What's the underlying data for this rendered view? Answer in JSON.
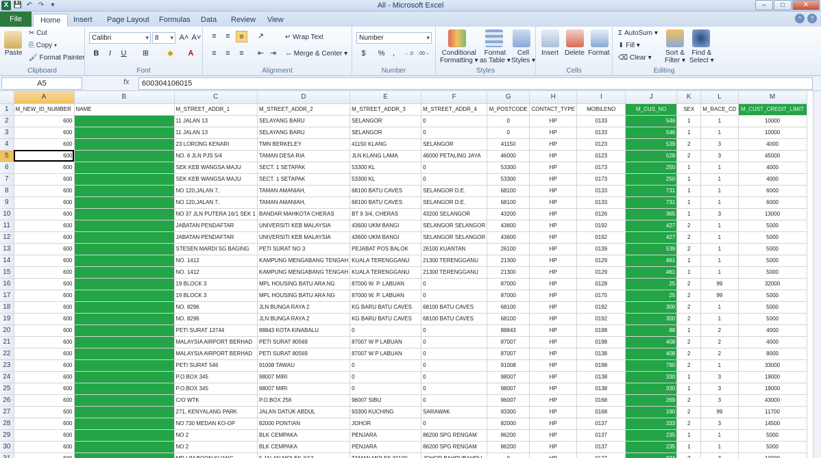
{
  "window": {
    "title": "All - Microsoft Excel",
    "min": "–",
    "max": "□",
    "close": "✕"
  },
  "quick_access": {
    "logo": "X",
    "save": "💾",
    "undo": "↶",
    "redo": "↷",
    "custom": "▾"
  },
  "tabs": [
    {
      "label": "File"
    },
    {
      "label": "Home"
    },
    {
      "label": "Insert"
    },
    {
      "label": "Page Layout"
    },
    {
      "label": "Formulas"
    },
    {
      "label": "Data"
    },
    {
      "label": "Review"
    },
    {
      "label": "View"
    }
  ],
  "ribbon": {
    "clipboard": {
      "paste": "Paste",
      "cut": "Cut",
      "copy": "Copy ▾",
      "format_painter": "Format Painter",
      "label": "Clipboard"
    },
    "font": {
      "name": "Calibri",
      "size": "8",
      "bold": "B",
      "italic": "I",
      "underline": "U",
      "grow": "A˄",
      "shrink": "A˅",
      "label": "Font"
    },
    "alignment": {
      "wrap": "Wrap Text",
      "merge": "Merge & Center",
      "label": "Alignment"
    },
    "number": {
      "format": "Number",
      "currency": "$",
      "percent": "%",
      "comma": ",",
      "inc": "←.0",
      "dec": ".00→",
      "label": "Number"
    },
    "styles": {
      "conditional": "Conditional",
      "conditional2": "Formatting ▾",
      "format_table": "Format",
      "format_table2": "as Table ▾",
      "cell_styles": "Cell",
      "cell_styles2": "Styles ▾",
      "label": "Styles"
    },
    "cells": {
      "insert": "Insert",
      "delete": "Delete",
      "format": "Format",
      "label": "Cells"
    },
    "editing": {
      "autosum": "Σ AutoSum ▾",
      "fill": "Fill ▾",
      "clear": "Clear ▾",
      "sort": "Sort &",
      "sort2": "Filter ▾",
      "find": "Find &",
      "find2": "Select ▾",
      "label": "Editing"
    }
  },
  "formula_bar": {
    "name_box": "A5",
    "fx": "fx",
    "content": "600304106015"
  },
  "columns": [
    "A",
    "B",
    "C",
    "D",
    "E",
    "F",
    "G",
    "H",
    "I",
    "J",
    "K",
    "L",
    "M"
  ],
  "header_row": [
    "M_NEW_ID_NUMBER",
    "NAME",
    "M_STREET_ADDR_1",
    "M_STREET_ADDR_2",
    "M_STREET_ADDR_3",
    "M_STREET_ADDR_4",
    "M_POSTCODE",
    "CONTACT_TYPE",
    "MOBILENO",
    "M_CUS_NO",
    "SEX",
    "M_RACE_CD",
    "M_CUST_CREDIT_LIMIT"
  ],
  "rows": [
    [
      "600",
      "",
      "11 JALAN 13",
      "SELAYANG BARU",
      "SELANGOR",
      "0",
      "0",
      "HP",
      "0133",
      "546",
      "1",
      "1",
      "10000"
    ],
    [
      "600",
      "",
      "11 JALAN 13",
      "SELAYANG BARU",
      "SELANGOR",
      "0",
      "0",
      "HP",
      "0133",
      "546",
      "1",
      "1",
      "10000"
    ],
    [
      "600",
      "",
      "23 LORONG KENARI",
      "TMN BERKELEY",
      "41150 KLANG",
      "SELANGOR",
      "41150",
      "HP",
      "0123",
      "539",
      "2",
      "3",
      "4000"
    ],
    [
      "600",
      "",
      "NO. 6 JLN PJS 5/4",
      "TAMAN DESA RIA",
      "JLN KLANG LAMA",
      "46000 PETALING JAYA",
      "46000",
      "HP",
      "0123",
      "528",
      "2",
      "3",
      "45000"
    ],
    [
      "600",
      "",
      "SEK KEB WANGSA MAJU",
      "SECT. 1 SETAPAK",
      "53300 KL",
      "0",
      "53300",
      "HP",
      "0173",
      "250",
      "1",
      "1",
      "4000"
    ],
    [
      "600",
      "",
      "SEK KEB WANGSA MAJU",
      "SECT. 1 SETAPAK",
      "53300 KL",
      "0",
      "53300",
      "HP",
      "0173",
      "250",
      "1",
      "1",
      "4000"
    ],
    [
      "600",
      "",
      "NO 120,JALAN 7,",
      "TAMAN AMANIAH,",
      "68100 BATU CAVES",
      "SELANGOR D.E.",
      "68100",
      "HP",
      "0133",
      "731",
      "1",
      "1",
      "6000"
    ],
    [
      "600",
      "",
      "NO 120,JALAN 7,",
      "TAMAN AMANIAH,",
      "68100 BATU CAVES",
      "SELANGOR D.E.",
      "68100",
      "HP",
      "0133",
      "731",
      "1",
      "1",
      "6000"
    ],
    [
      "600",
      "",
      "NO 37 JLN PUTERA 16/1 SEK 1",
      "BANDAR MAHKOTA CHERAS",
      "BT 9 3/4, CHERAS",
      "43200 SELANGOR",
      "43200",
      "HP",
      "0126",
      "365",
      "1",
      "3",
      "13000"
    ],
    [
      "600",
      "",
      "JABATAN PENDAFTAR",
      "UNIVERSITI KEB MALAYSIA",
      "43600 UKM BANGI",
      "SELANGOR SELANGOR",
      "43600",
      "HP",
      "0192",
      "427",
      "2",
      "1",
      "5000"
    ],
    [
      "600",
      "",
      "JABATAN PENDAFTAR",
      "UNIVERSITI KEB MALAYSIA",
      "43600 UKM BANGI",
      "SELANGOR SELANGOR",
      "43600",
      "HP",
      "0192",
      "427",
      "2",
      "1",
      "5000"
    ],
    [
      "600",
      "",
      "STESEN MARDI SG BAGING",
      "PETI SURAT NO 3",
      "PEJABAT POS BALOK",
      "26100 KUANTAN",
      "26100",
      "HP",
      "0139",
      "539",
      "2",
      "1",
      "5000"
    ],
    [
      "600",
      "",
      "NO. 1412",
      "KAMPUNG  MENGABANG TENGAH",
      "KUALA TERENGGANU",
      "21300 TERENGGANU",
      "21300",
      "HP",
      "0129",
      "461",
      "1",
      "1",
      "5000"
    ],
    [
      "600",
      "",
      "NO. 1412",
      "KAMPUNG  MENGABANG TENGAH",
      "KUALA TERENGGANU",
      "21300 TERENGGANU",
      "21300",
      "HP",
      "0129",
      "461",
      "1",
      "1",
      "5000"
    ],
    [
      "600",
      "",
      "19 BLOCK 3",
      "MPL HOUSING BATU ARA NG",
      "87000 W. P. LABUAN",
      "0",
      "87000",
      "HP",
      "0128",
      "25",
      "2",
      "99",
      "32000"
    ],
    [
      "600",
      "",
      "19 BLOCK 3",
      "MPL HOUSING BATU ARA NG",
      "87000 W. P. LABUAN",
      "0",
      "87000",
      "HP",
      "0175",
      "25",
      "2",
      "99",
      "5000"
    ],
    [
      "600",
      "",
      "NO. 8296",
      "JLN BUNGA RAYA 2",
      "KG BARU BATU CAVES",
      "68100 BATU CAVES",
      "68100",
      "HP",
      "0192",
      "300",
      "2",
      "1",
      "5000"
    ],
    [
      "600",
      "",
      "NO. 8296",
      "JLN BUNGA RAYA 2",
      "KG BARU BATU CAVES",
      "68100 BATU CAVES",
      "68100",
      "HP",
      "0192",
      "300",
      "2",
      "1",
      "5000"
    ],
    [
      "600",
      "",
      "PETI SURAT 13744",
      "88843 KOTA KINABALU",
      "0",
      "0",
      "88843",
      "HP",
      "0198",
      "88",
      "1",
      "2",
      "4000"
    ],
    [
      "600",
      "",
      "MALAYSIA AIRPORT BERHAD",
      "PETI SURAT 80569",
      "87007 W P LABUAN",
      "0",
      "87007",
      "HP",
      "0198",
      "408",
      "2",
      "2",
      "4000"
    ],
    [
      "600",
      "",
      "MALAYSIA AIRPORT BERHAD",
      "PETI SURAT 80569",
      "87007 W P LABUAN",
      "0",
      "87007",
      "HP",
      "0138",
      "408",
      "2",
      "2",
      "8000"
    ],
    [
      "600",
      "",
      "PETI SURAT 546",
      "91008 TAWAU",
      "0",
      "0",
      "91008",
      "HP",
      "0198",
      "790",
      "2",
      "1",
      "33000"
    ],
    [
      "600",
      "",
      "P.O.BOX 345",
      "98007 MIRI",
      "0",
      "0",
      "98007",
      "HP",
      "0138",
      "330",
      "1",
      "3",
      "19000"
    ],
    [
      "600",
      "",
      "P.O.BOX 345",
      "98007 MIRI",
      "0",
      "0",
      "98007",
      "HP",
      "0138",
      "330",
      "1",
      "3",
      "19000"
    ],
    [
      "600",
      "",
      "C/O WTK",
      "P.O.BOX 256",
      "96007 SIBU",
      "0",
      "96007",
      "HP",
      "0168",
      "269",
      "2",
      "3",
      "43000"
    ],
    [
      "600",
      "",
      "271, KENYALANG PARK",
      "JALAN DATUK ABDUL",
      "93300 KUCHING",
      "SARAWAK",
      "93300",
      "HP",
      "0168",
      "190",
      "2",
      "99",
      "11700"
    ],
    [
      "600",
      "",
      "NO 730 MEDAN KO-OP",
      "82000 PONTIAN",
      "JOHOR",
      "0",
      "82000",
      "HP",
      "0137",
      "333",
      "2",
      "3",
      "14500"
    ],
    [
      "600",
      "",
      "NO 2",
      "BLK CEMPAKA",
      "PENJARA",
      "86200 SPG RENGAM",
      "86200",
      "HP",
      "0137",
      "235",
      "1",
      "1",
      "5000"
    ],
    [
      "600",
      "",
      "NO 2",
      "BLK CEMPAKA",
      "PENJARA",
      "86200 SPG RENGAM",
      "86200",
      "HP",
      "0137",
      "235",
      "1",
      "1",
      "5000"
    ],
    [
      "600",
      "",
      "MR LIM BOON KUANG",
      "5 JALAN MOLEK 3/13",
      "TAMAN MOLEK 81100",
      "JOHOR BAHRUBAHRU",
      "0",
      "HP",
      "0127",
      "834",
      "2",
      "3",
      "10000"
    ]
  ],
  "accent": "#22a447"
}
